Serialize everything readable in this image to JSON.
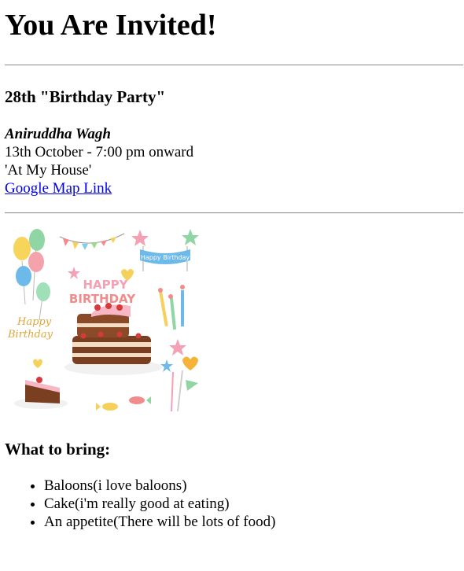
{
  "header": {
    "title": "You Are Invited!"
  },
  "event": {
    "title": "28th \"Birthday Party\"",
    "host": "Aniruddha Wagh",
    "datetime": "13th October - 7:00 pm onward",
    "venue": "'At My House'",
    "map_link_label": "Google Map Link"
  },
  "illustration": {
    "banner_text": "Happy Birthday",
    "cake_text_line1": "HAPPY",
    "cake_text_line2": "BIRTHDAY",
    "script_line1": "Happy",
    "script_line2": "Birthday"
  },
  "bring": {
    "heading": "What to bring:",
    "items": [
      "Baloons(i love baloons)",
      "Cake(i'm really good at eating)",
      "An appetite(There will be lots of food)"
    ]
  }
}
